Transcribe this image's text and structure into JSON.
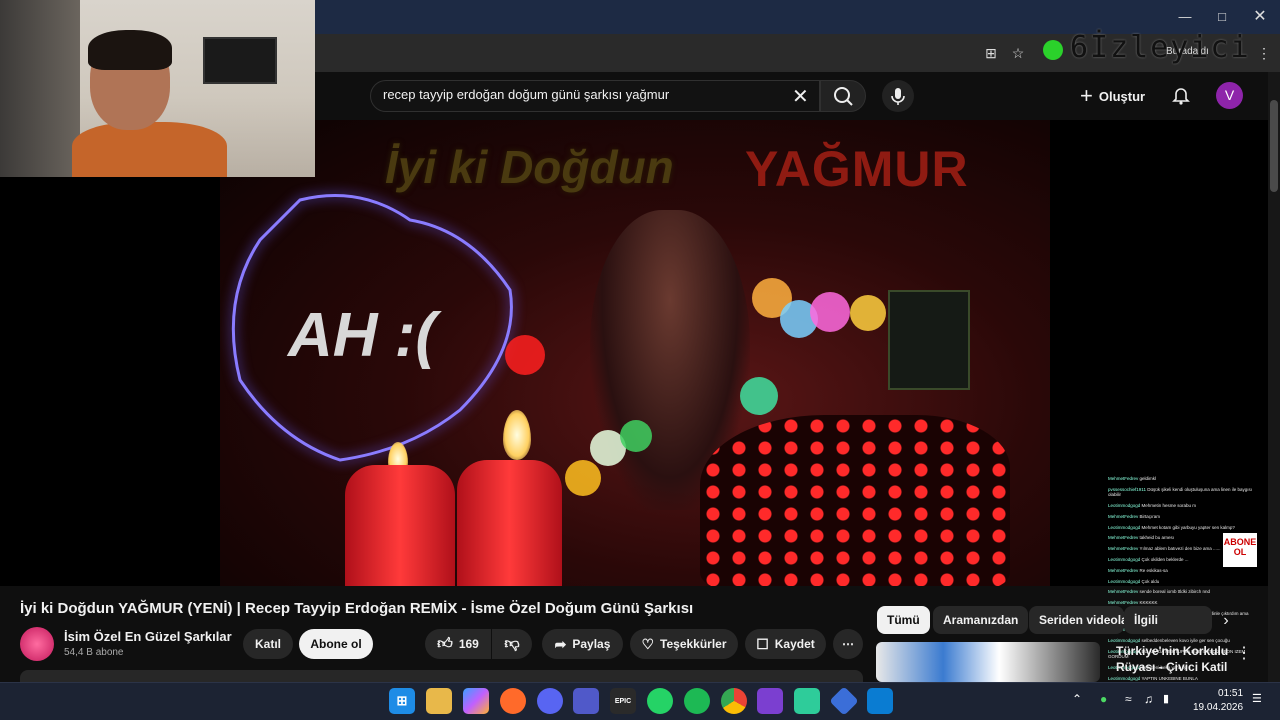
{
  "browser": {
    "address_right_text": "Buradaldı",
    "overlay_text": "6İzleyici"
  },
  "youtube": {
    "search_query": "recep tayyip erdoğan doğum günü şarkısı yağmur",
    "create_label": "Oluştur",
    "avatar_letter": "V"
  },
  "video": {
    "frame_text_1": "İyi ki Doğdun",
    "frame_text_2": "YAĞMUR",
    "frame_text_3": "AH :(",
    "title": "İyi ki Doğdun YAĞMUR (YENİ) | Recep Tayyip Erdoğan REMİX - İsme Özel Doğum Günü Şarkısı",
    "channel_name": "İsim Özel En Güzel Şarkılar",
    "channel_subs": "54,4 B abone",
    "join_label": "Katıl",
    "subscribe_label": "Abone ol",
    "like_count": "169",
    "share_label": "Paylaş",
    "thanks_label": "Teşekkürler",
    "save_label": "Kaydet"
  },
  "chips": {
    "all": "Tümü",
    "from_search": "Aramanızdan",
    "series": "Seriden videolar",
    "related": "İlgili"
  },
  "related": {
    "title": "Türkiye'nin Korkulu Rüyası - Çivici Katil ..."
  },
  "stream_chat": {
    "abone_badge": "ABONE OL",
    "lines": [
      {
        "user": "MehmetFedrev",
        "msg": "geldimkl"
      },
      {
        "user": "pvssessochief1911",
        "msg": "Düşük şikeli kendi oluştuluşuna ama linen ile baygısı olabilir"
      },
      {
        "user": "Leotimmodgogd",
        "msg": "Mehmetin hesme sorabu m"
      },
      {
        "user": "MehmetFedrev",
        "msg": "Birtaçıram"
      },
      {
        "user": "Leotimmodgogd",
        "msg": "Mehmet kotam gibi yarbuyu yapter sen kalmp?"
      },
      {
        "user": "MehmetFedrev",
        "msg": "takheid bu arnesı"
      },
      {
        "user": "MehmetFedrev",
        "msg": "Yılmaz ablem batıvezi den bize ama ......"
      },
      {
        "user": "Leotimmodgogd",
        "msg": "Çok okilden beklerde ..."
      },
      {
        "user": "MehmetFedrev",
        "msg": "Re eskikas-sa"
      },
      {
        "user": "Leotimmodgogd",
        "msg": "Çok aldu"
      },
      {
        "user": "MehmetFedrev",
        "msg": "sende boreal iomb ttldki zibirch nnd"
      },
      {
        "user": "MehmetFedrev",
        "msg": "KKKKKK"
      },
      {
        "user": "pvssessochief1911",
        "msg": "Bir en öküzü beni dğnan sapatı dinle çıktırdım ama ormat"
      },
      {
        "user": "Leotimmodgogd",
        "msg": "ölü kenas bacım cb"
      },
      {
        "user": "Leotimmodgogd",
        "msg": "selbeddenbeleven kovo iyile ger sen çocuğu"
      },
      {
        "user": "Leotimmodgogd",
        "msg": "BU ARADA MEKTUPDA BIZE ISTEDIZ LEON IZEM GORDUM"
      },
      {
        "user": "Leotimmodgogd",
        "msg": "Ben beni beka yaha iş"
      },
      {
        "user": "Leotimmodgogd",
        "msg": "YAPTIN UNKEBINE BUNLA"
      }
    ]
  },
  "taskbar": {
    "time": "01:51",
    "date": "19.04.2026"
  }
}
